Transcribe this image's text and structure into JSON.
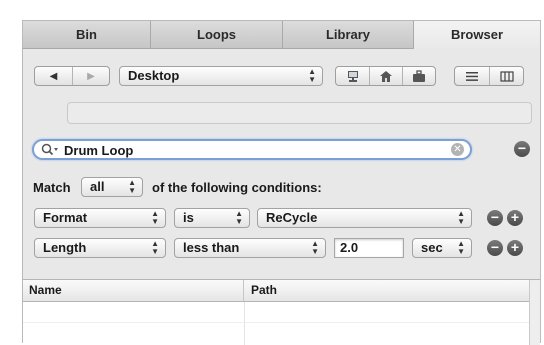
{
  "tabs": [
    {
      "label": "Bin"
    },
    {
      "label": "Loops"
    },
    {
      "label": "Library"
    },
    {
      "label": "Browser"
    }
  ],
  "nav": {
    "location": "Desktop"
  },
  "search": {
    "value": "Drum Loop"
  },
  "match": {
    "prefix": "Match",
    "mode": "all",
    "suffix": "of the following conditions:"
  },
  "conditions": [
    {
      "field": "Format",
      "operator": "is",
      "value": "ReCycle"
    },
    {
      "field": "Length",
      "operator": "less than",
      "value": "2.0",
      "unit": "sec"
    }
  ],
  "table": {
    "columns": [
      "Name",
      "Path"
    ]
  },
  "icons": {
    "back": "back-arrow-icon",
    "forward": "forward-arrow-icon",
    "computer": "computer-icon",
    "home": "home-icon",
    "briefcase": "briefcase-icon",
    "list_view": "list-view-icon",
    "column_view": "column-view-icon",
    "search": "search-icon",
    "clear": "clear-icon",
    "remove": "minus-icon",
    "add": "plus-icon"
  }
}
